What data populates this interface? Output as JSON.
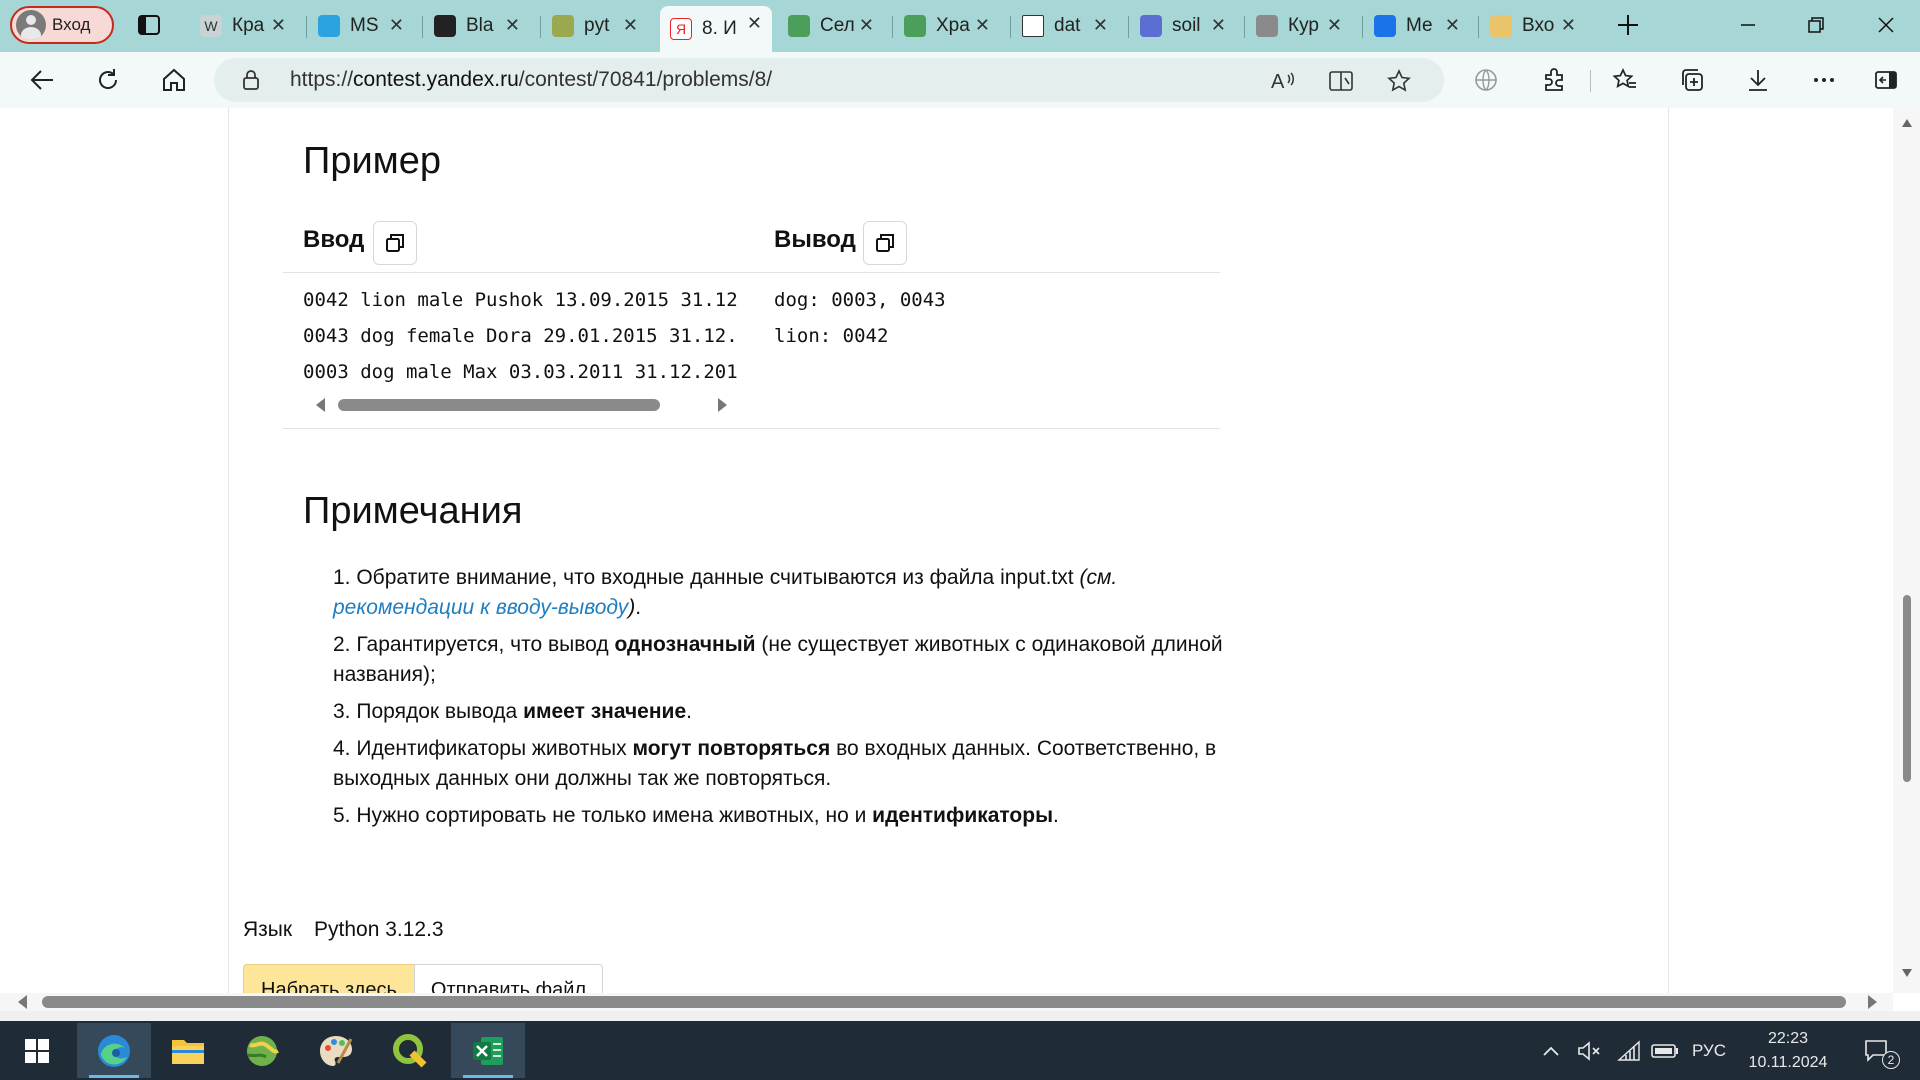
{
  "browser": {
    "profile_label": "Вход",
    "tabs": [
      {
        "title": "Кра",
        "icon": "wikipedia-icon"
      },
      {
        "title": "MS",
        "icon": "telegram-icon"
      },
      {
        "title": "Bla",
        "icon": "github-icon"
      },
      {
        "title": "pyt",
        "icon": "folder-icon"
      },
      {
        "title": "8. И",
        "icon": "yandex-icon"
      },
      {
        "title": "Сел",
        "icon": "google-drive-icon"
      },
      {
        "title": "Хра",
        "icon": "google-drive-icon"
      },
      {
        "title": "dat",
        "icon": "file-icon"
      },
      {
        "title": "soil",
        "icon": "form-icon"
      },
      {
        "title": "Кур",
        "icon": "cloud-icon"
      },
      {
        "title": "Ме",
        "icon": "messenger-icon"
      },
      {
        "title": "Вхо",
        "icon": "mail-icon"
      }
    ],
    "active_tab": 4,
    "url_scheme": "https://",
    "url_host": "contest.yandex.ru",
    "url_path": "/contest/70841/problems/8/",
    "accent": "#a7d6d6"
  },
  "problem": {
    "example_heading": "Пример",
    "input_label": "Ввод",
    "output_label": "Вывод",
    "input_lines": [
      "0042 lion male Pushok 13.09.2015 31.12",
      "0043 dog female Dora 29.01.2015 31.12.",
      "0003 dog male Max 03.03.2011 31.12.201"
    ],
    "output_lines": [
      "dog: 0003, 0043",
      "lion: 0042"
    ],
    "notes_heading": "Примечания",
    "notes": [
      {
        "n": "1.",
        "pre": " Обратите внимание, что входные данные считываются из файла input.txt ",
        "italic_pre": "(см. ",
        "link": "рекомендации к вводу-выводу",
        "italic_post": ")",
        "post": "."
      },
      {
        "n": "2.",
        "pre": " Гарантируется, что вывод ",
        "bold": "однозначный",
        "post": " (не существует животных с одинаковой длиной названия);"
      },
      {
        "n": "3.",
        "pre": " Порядок вывода ",
        "bold": "имеет значение",
        "post": "."
      },
      {
        "n": "4.",
        "pre": " Идентификаторы животных ",
        "bold": "могут повторяться",
        "post": " во входных данных. Соответственно, в выходных данных они должны так же повторяться."
      },
      {
        "n": "5.",
        "pre": " Нужно сортировать не только имена животных, но и ",
        "bold": "идентификаторы",
        "post": "."
      }
    ],
    "language_label": "Язык",
    "language_value": "Python 3.12.3",
    "editor_tabs": [
      "Набрать здесь",
      "Отправить файл"
    ],
    "link_color": "#1f7ec2"
  },
  "taskbar": {
    "apps": [
      "windows-start-icon",
      "edge-icon",
      "file-explorer-icon",
      "qgis-globe-icon",
      "paint-icon",
      "qgis-icon",
      "excel-icon"
    ],
    "language": "РУС",
    "time": "22:23",
    "date": "10.11.2024",
    "notification_count": "2"
  }
}
